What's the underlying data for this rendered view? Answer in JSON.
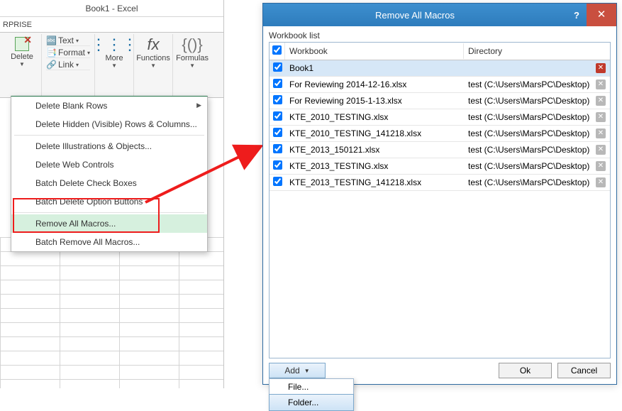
{
  "excel": {
    "title": "Book1 - Excel",
    "tab": "RPRISE",
    "ribbon": {
      "delete_label": "Delete",
      "text_label": "Text",
      "format_label": "Format",
      "link_label": "Link",
      "more_label": "More",
      "functions_label": "Functions",
      "formulas_label": "Formulas",
      "fx_icon_text": "fx",
      "braces_icon_text": "{()}"
    },
    "menu": {
      "items": [
        "Delete Blank Rows",
        "Delete Hidden (Visible) Rows & Columns...",
        "Delete Illustrations & Objects...",
        "Delete Web Controls",
        "Batch Delete Check Boxes",
        "Batch Delete Option Buttons",
        "Remove All Macros...",
        "Batch Remove All Macros..."
      ]
    }
  },
  "dialog": {
    "title": "Remove All Macros",
    "workbook_list_label": "Workbook list",
    "columns": {
      "workbook": "Workbook",
      "directory": "Directory"
    },
    "rows": [
      {
        "workbook": "Book1",
        "directory": "",
        "selected": true
      },
      {
        "workbook": "For Reviewing 2014-12-16.xlsx",
        "directory": "test (C:\\Users\\MarsPC\\Desktop)"
      },
      {
        "workbook": "For Reviewing 2015-1-13.xlsx",
        "directory": "test (C:\\Users\\MarsPC\\Desktop)"
      },
      {
        "workbook": "KTE_2010_TESTING.xlsx",
        "directory": "test (C:\\Users\\MarsPC\\Desktop)"
      },
      {
        "workbook": "KTE_2010_TESTING_141218.xlsx",
        "directory": "test (C:\\Users\\MarsPC\\Desktop)"
      },
      {
        "workbook": "KTE_2013_150121.xlsx",
        "directory": "test (C:\\Users\\MarsPC\\Desktop)"
      },
      {
        "workbook": "KTE_2013_TESTING.xlsx",
        "directory": "test (C:\\Users\\MarsPC\\Desktop)"
      },
      {
        "workbook": "KTE_2013_TESTING_141218.xlsx",
        "directory": "test (C:\\Users\\MarsPC\\Desktop)"
      }
    ],
    "add_label": "Add",
    "add_menu": {
      "file": "File...",
      "folder": "Folder..."
    },
    "ok_label": "Ok",
    "cancel_label": "Cancel"
  }
}
